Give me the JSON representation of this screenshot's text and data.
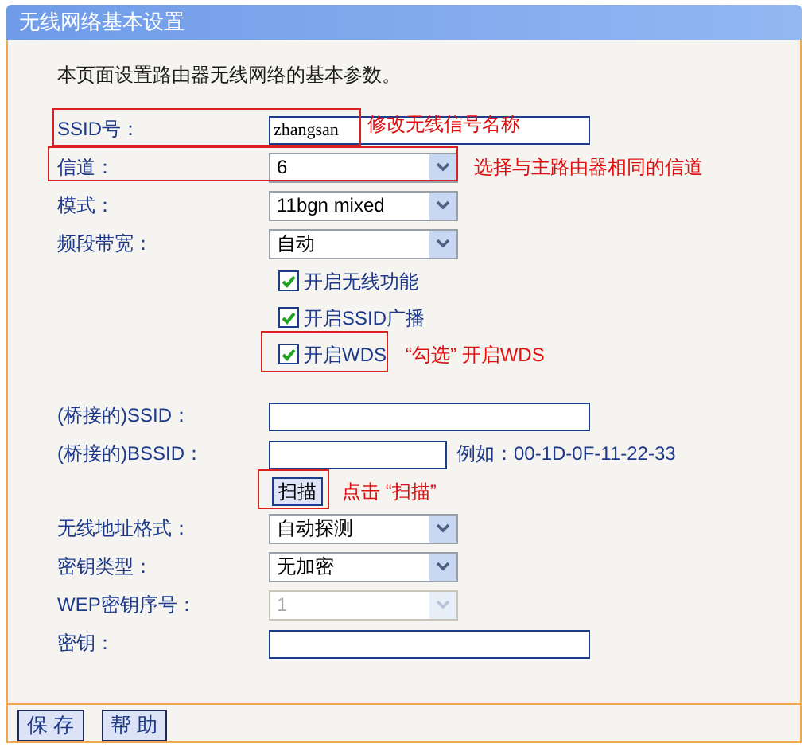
{
  "window": {
    "title": "无线网络基本设置"
  },
  "description": "本页面设置路由器无线网络的基本参数。",
  "rows": [
    {
      "kind": "text",
      "label": "SSID号：",
      "value": "zhangsan",
      "highlighted": true,
      "note": "修改无线信号名称"
    },
    {
      "kind": "select",
      "label": "信道：",
      "value": "6",
      "disabled": false,
      "highlighted": true,
      "note": "选择与主路由器相同的信道"
    },
    {
      "kind": "select",
      "label": "模式：",
      "value": "11bgn mixed",
      "disabled": false,
      "highlighted": false
    },
    {
      "kind": "select",
      "label": "频段带宽：",
      "value": "自动",
      "disabled": false,
      "highlighted": false
    },
    {
      "kind": "checkbox",
      "label": "开启无线功能",
      "checked": true,
      "highlighted": false
    },
    {
      "kind": "checkbox",
      "label": "开启SSID广播",
      "checked": true,
      "highlighted": false
    },
    {
      "kind": "checkbox",
      "label": "开启WDS",
      "checked": true,
      "highlighted": true,
      "note": "“勾选” 开启WDS"
    },
    {
      "kind": "spacer"
    },
    {
      "kind": "text",
      "label": "(桥接的)SSID：",
      "highlighted": false
    },
    {
      "kind": "text",
      "label": "(桥接的)BSSID：",
      "hint": "例如：00-1D-0F-11-22-33",
      "highlighted": false
    },
    {
      "kind": "button",
      "label": "扫描",
      "highlighted": true,
      "note": "点击 “扫描”"
    },
    {
      "kind": "select",
      "label": "无线地址格式：",
      "value": "自动探测",
      "disabled": false,
      "highlighted": false
    },
    {
      "kind": "select",
      "label": "密钥类型：",
      "value": "无加密",
      "disabled": false,
      "highlighted": false
    },
    {
      "kind": "select",
      "label": "WEP密钥序号：",
      "value": "1",
      "disabled": true,
      "highlighted": false
    },
    {
      "kind": "text",
      "label": "密钥：",
      "highlighted": false
    }
  ],
  "buttons": [
    "保 存",
    "帮 助"
  ]
}
